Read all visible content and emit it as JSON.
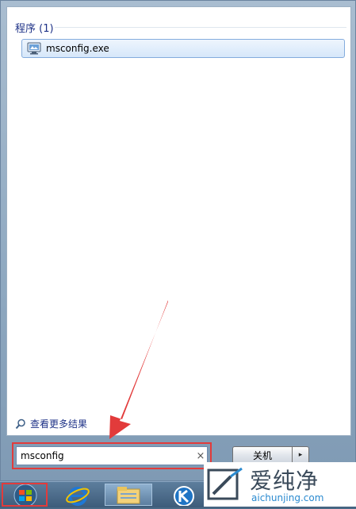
{
  "results": {
    "section_header": "程序 (1)",
    "items": [
      {
        "label": "msconfig.exe",
        "icon": "msconfig-app-icon"
      }
    ],
    "see_more_label": "查看更多结果"
  },
  "search": {
    "value": "msconfig",
    "clear_glyph": "×"
  },
  "power": {
    "shutdown_label": "关机",
    "arrow_glyph": "▸"
  },
  "taskbar": {
    "items": [
      "start-orb-icon",
      "internet-explorer-icon",
      "file-explorer-icon",
      "k-app-icon"
    ]
  },
  "watermark": {
    "brand_cn": "爱纯净",
    "url": "aichunjing.com"
  },
  "colors": {
    "annotation": "#e23b3b",
    "accent_link": "#1e3287"
  }
}
